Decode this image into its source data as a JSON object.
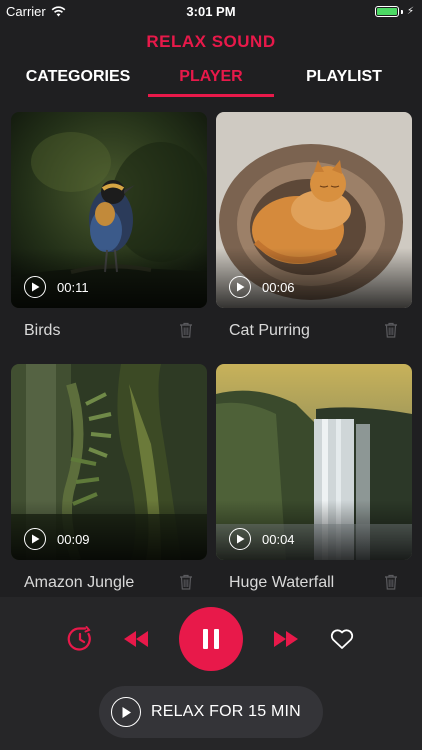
{
  "status_bar": {
    "carrier": "Carrier",
    "time": "3:01 PM",
    "battery_percent": 100,
    "wifi_icon": "wifi-icon",
    "battery_icon": "battery-charging-icon"
  },
  "header": {
    "title": "RELAX SOUND",
    "tabs": [
      {
        "label": "CATEGORIES",
        "active": false
      },
      {
        "label": "PLAYER",
        "active": true
      },
      {
        "label": "PLAYLIST",
        "active": false
      }
    ]
  },
  "sounds": [
    {
      "title": "Birds",
      "duration": "00:11",
      "image": "bird-on-branch"
    },
    {
      "title": "Cat Purring",
      "duration": "00:06",
      "image": "sleeping-cat"
    },
    {
      "title": "Amazon Jungle",
      "duration": "00:09",
      "image": "jungle-trees"
    },
    {
      "title": "Huge Waterfall",
      "duration": "00:04",
      "image": "waterfall"
    }
  ],
  "player": {
    "controls": [
      "timer-icon",
      "rewind-icon",
      "pause-icon",
      "fast-forward-icon",
      "heart-icon"
    ],
    "relax_label": "RELAX FOR 15 MIN"
  },
  "colors": {
    "accent": "#e8194a",
    "background": "#1f1f21",
    "panel": "#262628"
  }
}
